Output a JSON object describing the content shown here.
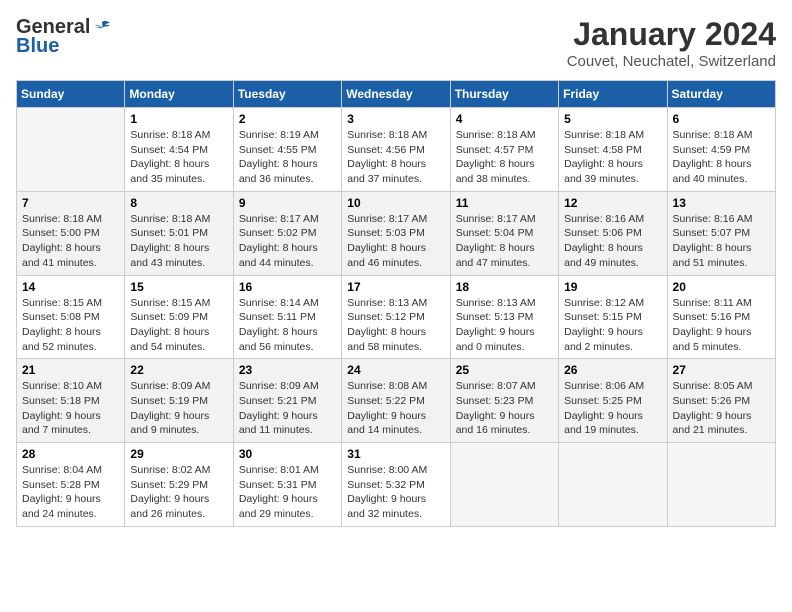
{
  "header": {
    "logo_general": "General",
    "logo_blue": "Blue",
    "month": "January 2024",
    "location": "Couvet, Neuchatel, Switzerland"
  },
  "weekdays": [
    "Sunday",
    "Monday",
    "Tuesday",
    "Wednesday",
    "Thursday",
    "Friday",
    "Saturday"
  ],
  "weeks": [
    [
      {
        "day": "",
        "info": ""
      },
      {
        "day": "1",
        "info": "Sunrise: 8:18 AM\nSunset: 4:54 PM\nDaylight: 8 hours\nand 35 minutes."
      },
      {
        "day": "2",
        "info": "Sunrise: 8:19 AM\nSunset: 4:55 PM\nDaylight: 8 hours\nand 36 minutes."
      },
      {
        "day": "3",
        "info": "Sunrise: 8:18 AM\nSunset: 4:56 PM\nDaylight: 8 hours\nand 37 minutes."
      },
      {
        "day": "4",
        "info": "Sunrise: 8:18 AM\nSunset: 4:57 PM\nDaylight: 8 hours\nand 38 minutes."
      },
      {
        "day": "5",
        "info": "Sunrise: 8:18 AM\nSunset: 4:58 PM\nDaylight: 8 hours\nand 39 minutes."
      },
      {
        "day": "6",
        "info": "Sunrise: 8:18 AM\nSunset: 4:59 PM\nDaylight: 8 hours\nand 40 minutes."
      }
    ],
    [
      {
        "day": "7",
        "info": "Sunrise: 8:18 AM\nSunset: 5:00 PM\nDaylight: 8 hours\nand 41 minutes."
      },
      {
        "day": "8",
        "info": "Sunrise: 8:18 AM\nSunset: 5:01 PM\nDaylight: 8 hours\nand 43 minutes."
      },
      {
        "day": "9",
        "info": "Sunrise: 8:17 AM\nSunset: 5:02 PM\nDaylight: 8 hours\nand 44 minutes."
      },
      {
        "day": "10",
        "info": "Sunrise: 8:17 AM\nSunset: 5:03 PM\nDaylight: 8 hours\nand 46 minutes."
      },
      {
        "day": "11",
        "info": "Sunrise: 8:17 AM\nSunset: 5:04 PM\nDaylight: 8 hours\nand 47 minutes."
      },
      {
        "day": "12",
        "info": "Sunrise: 8:16 AM\nSunset: 5:06 PM\nDaylight: 8 hours\nand 49 minutes."
      },
      {
        "day": "13",
        "info": "Sunrise: 8:16 AM\nSunset: 5:07 PM\nDaylight: 8 hours\nand 51 minutes."
      }
    ],
    [
      {
        "day": "14",
        "info": "Sunrise: 8:15 AM\nSunset: 5:08 PM\nDaylight: 8 hours\nand 52 minutes."
      },
      {
        "day": "15",
        "info": "Sunrise: 8:15 AM\nSunset: 5:09 PM\nDaylight: 8 hours\nand 54 minutes."
      },
      {
        "day": "16",
        "info": "Sunrise: 8:14 AM\nSunset: 5:11 PM\nDaylight: 8 hours\nand 56 minutes."
      },
      {
        "day": "17",
        "info": "Sunrise: 8:13 AM\nSunset: 5:12 PM\nDaylight: 8 hours\nand 58 minutes."
      },
      {
        "day": "18",
        "info": "Sunrise: 8:13 AM\nSunset: 5:13 PM\nDaylight: 9 hours\nand 0 minutes."
      },
      {
        "day": "19",
        "info": "Sunrise: 8:12 AM\nSunset: 5:15 PM\nDaylight: 9 hours\nand 2 minutes."
      },
      {
        "day": "20",
        "info": "Sunrise: 8:11 AM\nSunset: 5:16 PM\nDaylight: 9 hours\nand 5 minutes."
      }
    ],
    [
      {
        "day": "21",
        "info": "Sunrise: 8:10 AM\nSunset: 5:18 PM\nDaylight: 9 hours\nand 7 minutes."
      },
      {
        "day": "22",
        "info": "Sunrise: 8:09 AM\nSunset: 5:19 PM\nDaylight: 9 hours\nand 9 minutes."
      },
      {
        "day": "23",
        "info": "Sunrise: 8:09 AM\nSunset: 5:21 PM\nDaylight: 9 hours\nand 11 minutes."
      },
      {
        "day": "24",
        "info": "Sunrise: 8:08 AM\nSunset: 5:22 PM\nDaylight: 9 hours\nand 14 minutes."
      },
      {
        "day": "25",
        "info": "Sunrise: 8:07 AM\nSunset: 5:23 PM\nDaylight: 9 hours\nand 16 minutes."
      },
      {
        "day": "26",
        "info": "Sunrise: 8:06 AM\nSunset: 5:25 PM\nDaylight: 9 hours\nand 19 minutes."
      },
      {
        "day": "27",
        "info": "Sunrise: 8:05 AM\nSunset: 5:26 PM\nDaylight: 9 hours\nand 21 minutes."
      }
    ],
    [
      {
        "day": "28",
        "info": "Sunrise: 8:04 AM\nSunset: 5:28 PM\nDaylight: 9 hours\nand 24 minutes."
      },
      {
        "day": "29",
        "info": "Sunrise: 8:02 AM\nSunset: 5:29 PM\nDaylight: 9 hours\nand 26 minutes."
      },
      {
        "day": "30",
        "info": "Sunrise: 8:01 AM\nSunset: 5:31 PM\nDaylight: 9 hours\nand 29 minutes."
      },
      {
        "day": "31",
        "info": "Sunrise: 8:00 AM\nSunset: 5:32 PM\nDaylight: 9 hours\nand 32 minutes."
      },
      {
        "day": "",
        "info": ""
      },
      {
        "day": "",
        "info": ""
      },
      {
        "day": "",
        "info": ""
      }
    ]
  ]
}
